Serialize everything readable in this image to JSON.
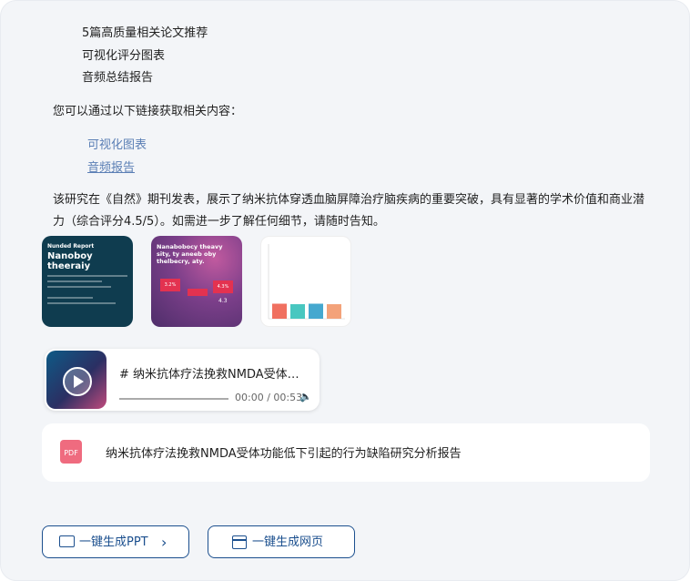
{
  "bullets": [
    "5篇高质量相关论文推荐",
    "可视化评分图表",
    "音频总结报告"
  ],
  "intro": "您可以通过以下链接获取相关内容：",
  "links": [
    {
      "label": "可视化图表"
    },
    {
      "label": "音频报告"
    }
  ],
  "summary": "该研究在《自然》期刊发表，展示了纳米抗体穿透血脑屏障治疗脑疾病的重要突破，具有显著的学术价值和商业潜力（综合评分4.5/5）。如需进一步了解任何细节，请随时告知。",
  "thumbnails": {
    "t1": {
      "eyebrow": "Nunded Report",
      "title": "Nanoboy theeraiy"
    },
    "t2": {
      "title": "Nanabobocy theavy sity, ty aneeb oby thelbecry, aty.",
      "values": [
        "3.2%",
        "4.3%",
        "4.3"
      ]
    },
    "t3": {
      "bars": [
        3.1,
        3.0,
        3.1,
        3.0
      ],
      "colors": [
        "#f07060",
        "#48c7c0",
        "#45a8cf",
        "#f3a27a"
      ]
    }
  },
  "audio": {
    "title": "# 纳米抗体疗法挽救NMDA受体功能低下引起的行为缺陷研究分析报告",
    "time": "00:00 / 00:53",
    "volume_icon": "volume-icon"
  },
  "file": {
    "type": "PDF",
    "title": "纳米抗体疗法挽救NMDA受体功能低下引起的行为缺陷研究分析报告"
  },
  "buttons": {
    "ppt": "一键生成PPT",
    "web": "一键生成网页"
  }
}
